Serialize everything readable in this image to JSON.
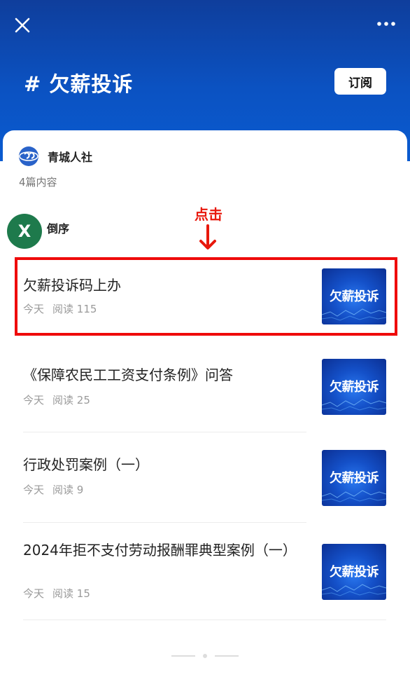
{
  "header": {
    "title": "# 欠薪投诉",
    "subscribe_label": "订阅",
    "close_icon": "close-icon",
    "more_icon": "more-icon",
    "background": "#0b52c2"
  },
  "account": {
    "name": "青城人社",
    "logo_icon": "account-logo-icon",
    "article_count": "4篇内容"
  },
  "sort": {
    "label": "倒序"
  },
  "floating_close": {
    "label": "X",
    "color": "#1e7a4c"
  },
  "annotation": {
    "text": "点击",
    "color": "#e8180c"
  },
  "articles": [
    {
      "title": "欠薪投诉码上办",
      "date": "今天",
      "reads": "阅读 115",
      "thumb_text": "欠薪投诉"
    },
    {
      "title": "《保障农民工工资支付条例》问答",
      "date": "今天",
      "reads": "阅读 25",
      "thumb_text": "欠薪投诉"
    },
    {
      "title": "行政处罚案例（一）",
      "date": "今天",
      "reads": "阅读 9",
      "thumb_text": "欠薪投诉"
    },
    {
      "title": "2024年拒不支付劳动报酬罪典型案例（一）",
      "date": "今天",
      "reads": "阅读 15",
      "thumb_text": "欠薪投诉"
    }
  ]
}
